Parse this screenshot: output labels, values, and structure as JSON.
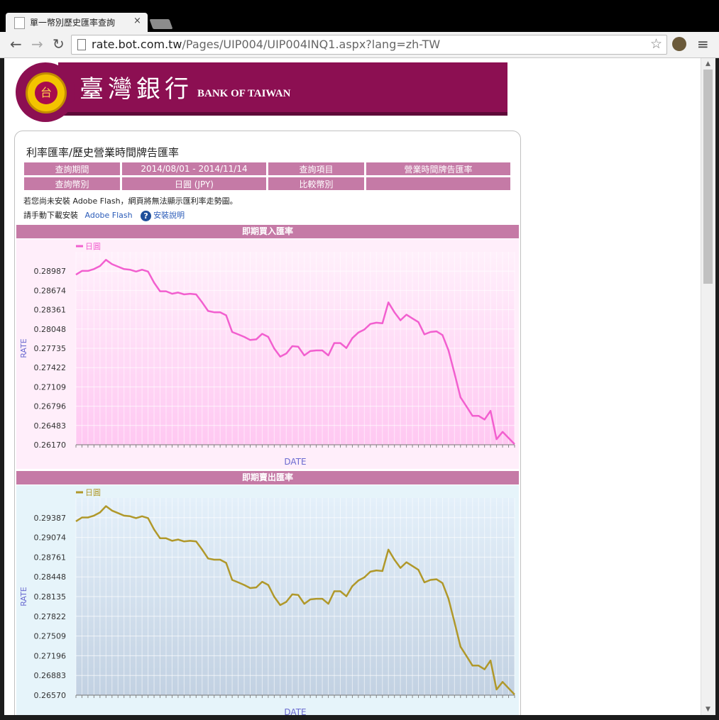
{
  "browser": {
    "tab_title": "單一幣別歷史匯率查詢",
    "tab_close": "×",
    "url_host": "rate.bot.com.tw",
    "url_path": "/Pages/UIP004/UIP004INQ1.aspx?lang=zh-TW",
    "back_icon": "←",
    "forward_icon": "→",
    "reload_icon": "↻",
    "star_icon": "☆",
    "menu_icon": "≡"
  },
  "banner": {
    "name_zh": "臺灣銀行",
    "name_en": "BANK OF TAIWAN",
    "logo_glyph": "台"
  },
  "panel": {
    "title": "利率匯率/歷史營業時間牌告匯率",
    "row1": {
      "label1": "查詢期間",
      "value1": "2014/08/01 - 2014/11/14",
      "label2": "查詢項目",
      "value2": "營業時間牌告匯率"
    },
    "row2": {
      "label1": "查詢幣別",
      "value1": "日圓 (JPY)",
      "label2": "比較幣別",
      "value2": ""
    },
    "note1": "若您尚未安裝 Adobe Flash，網頁將無法顯示匯利率走勢圖。",
    "note2_prefix": "請手動下載安裝",
    "note2_link": "Adobe Flash",
    "note2_help": "安裝說明",
    "help_glyph": "?"
  },
  "sections": {
    "buy": "即期買入匯率",
    "sell": "即期賣出匯率"
  },
  "chart_data": [
    {
      "type": "line",
      "title": "即期買入匯率",
      "xlabel": "DATE",
      "ylabel": "RATE",
      "ylim": [
        0.2617,
        0.293
      ],
      "yticks": [
        "0.26170",
        "0.26483",
        "0.26796",
        "0.27109",
        "0.27422",
        "0.27735",
        "0.28048",
        "0.28361",
        "0.28674",
        "0.28987"
      ],
      "grid": true,
      "legend": "top-left",
      "series": [
        {
          "name": "日圓",
          "color": "#f25fcf",
          "values": [
            0.2893,
            0.2899,
            0.2899,
            0.2902,
            0.2907,
            0.2917,
            0.291,
            0.2906,
            0.2902,
            0.2901,
            0.2898,
            0.2901,
            0.2898,
            0.288,
            0.2866,
            0.2866,
            0.2862,
            0.2864,
            0.2861,
            0.2862,
            0.2861,
            0.2848,
            0.2834,
            0.2832,
            0.2832,
            0.2827,
            0.28,
            0.2796,
            0.2792,
            0.2787,
            0.2788,
            0.2797,
            0.2792,
            0.2773,
            0.276,
            0.2765,
            0.2777,
            0.2776,
            0.2762,
            0.2769,
            0.277,
            0.277,
            0.2762,
            0.2782,
            0.2782,
            0.2774,
            0.279,
            0.2799,
            0.2804,
            0.2813,
            0.2815,
            0.2814,
            0.2848,
            0.2832,
            0.2819,
            0.2828,
            0.2822,
            0.2816,
            0.2796,
            0.28,
            0.2801,
            0.2795,
            0.277,
            0.2733,
            0.2694,
            0.2679,
            0.2664,
            0.2664,
            0.2658,
            0.2672,
            0.2626,
            0.2638,
            0.2628,
            0.2618
          ]
        }
      ]
    },
    {
      "type": "line",
      "title": "即期賣出匯率",
      "xlabel": "DATE",
      "ylabel": "RATE",
      "ylim": [
        0.2657,
        0.297
      ],
      "yticks": [
        "0.26570",
        "0.26883",
        "0.27196",
        "0.27509",
        "0.27822",
        "0.28135",
        "0.28448",
        "0.28761",
        "0.29074",
        "0.29387"
      ],
      "grid": true,
      "legend": "top-left",
      "series": [
        {
          "name": "日圓",
          "color": "#b0982a",
          "values": [
            0.2933,
            0.2939,
            0.2939,
            0.2942,
            0.2947,
            0.2957,
            0.295,
            0.2946,
            0.2942,
            0.2941,
            0.2938,
            0.2941,
            0.2938,
            0.292,
            0.2906,
            0.2906,
            0.2902,
            0.2904,
            0.2901,
            0.2902,
            0.2901,
            0.2888,
            0.2874,
            0.2872,
            0.2872,
            0.2867,
            0.284,
            0.2836,
            0.2832,
            0.2827,
            0.2828,
            0.2837,
            0.2832,
            0.2813,
            0.28,
            0.2805,
            0.2817,
            0.2816,
            0.2802,
            0.2809,
            0.281,
            0.281,
            0.2802,
            0.2822,
            0.2822,
            0.2814,
            0.283,
            0.2839,
            0.2844,
            0.2853,
            0.2855,
            0.2854,
            0.2888,
            0.2872,
            0.2859,
            0.2868,
            0.2862,
            0.2856,
            0.2836,
            0.284,
            0.2841,
            0.2835,
            0.281,
            0.2773,
            0.2734,
            0.2719,
            0.2704,
            0.2704,
            0.2698,
            0.2712,
            0.2666,
            0.2678,
            0.2668,
            0.2658
          ]
        }
      ]
    }
  ]
}
